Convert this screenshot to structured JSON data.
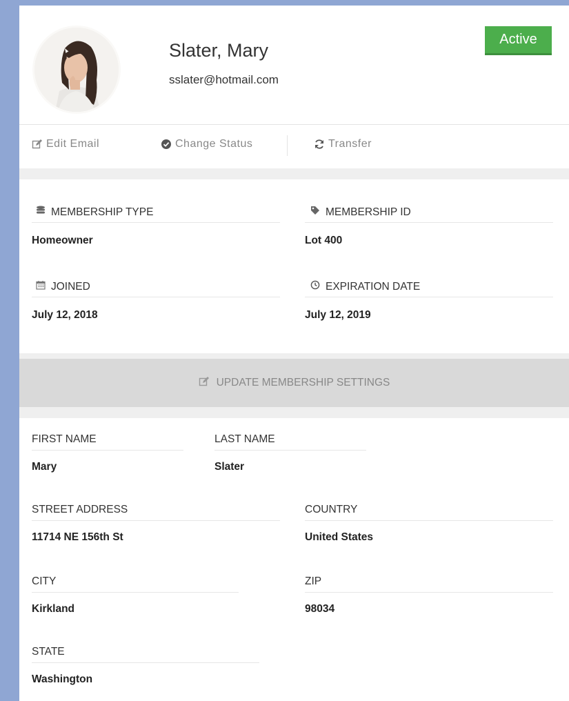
{
  "profile": {
    "name": "Slater, Mary",
    "email": "sslater@hotmail.com",
    "status": "Active"
  },
  "actions": {
    "edit_email": "Edit Email",
    "change_status": "Change Status",
    "transfer": "Transfer"
  },
  "membership": {
    "type_label": "MEMBERSHIP TYPE",
    "type_value": "Homeowner",
    "id_label": "MEMBERSHIP ID",
    "id_value": "Lot 400",
    "joined_label": "JOINED",
    "joined_value": "July 12, 2018",
    "expiration_label": "EXPIRATION DATE",
    "expiration_value": "July 12, 2019"
  },
  "update_button": "UPDATE MEMBERSHIP SETTINGS",
  "details": {
    "first_name_label": "FIRST NAME",
    "first_name_value": "Mary",
    "last_name_label": "LAST NAME",
    "last_name_value": "Slater",
    "street_label": "STREET ADDRESS",
    "street_value": "11714 NE 156th St",
    "country_label": "COUNTRY",
    "country_value": "United States",
    "city_label": "CITY",
    "city_value": "Kirkland",
    "zip_label": "ZIP",
    "zip_value": "98034",
    "state_label": "STATE",
    "state_value": "Washington"
  },
  "colors": {
    "page_background": "#8fa6d3",
    "status_active": "#4cae4c",
    "muted_text": "#888888"
  },
  "icons": {
    "edit_email": "pencil-square-icon",
    "change_status": "check-circle-icon",
    "transfer": "refresh-icon",
    "membership_type": "database-icon",
    "membership_id": "tag-icon",
    "joined": "calendar-icon",
    "expiration": "clock-icon",
    "update": "pencil-square-icon"
  }
}
